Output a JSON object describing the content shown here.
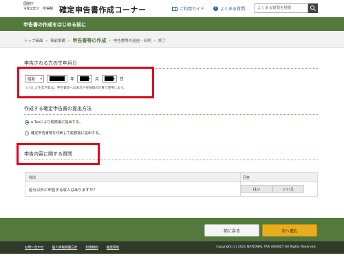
{
  "header": {
    "agency_line1": "国税庁",
    "agency_line2": "令和2年分　所得税",
    "title": "確定申告書作成コーナー",
    "guide_link": "ご利用ガイド",
    "faq_link": "よくある質問",
    "search_placeholder": "よくある質問を検索"
  },
  "banner": {
    "title": "申告書の作成をはじめる前に"
  },
  "breadcrumb": [
    {
      "label": "トップ画面",
      "current": false
    },
    {
      "label": "事前準備",
      "current": false
    },
    {
      "label": "申告書等の作成",
      "current": true
    },
    {
      "label": "申告書等の送信・印刷",
      "current": false
    },
    {
      "label": "終了",
      "current": false
    }
  ],
  "birthday": {
    "heading": "申告される方の生年月日",
    "era_value": "昭和",
    "year_unit": "年",
    "month_unit": "月",
    "day_unit": "日",
    "note": "入力した生年月日は、申告書等への表示や控除額の計算で使用します。"
  },
  "submission": {
    "heading": "作成する確定申告書の提出方法",
    "option1": "e-Taxにより税務署に提出する。",
    "option2": "確定申告書等を印刷して税務署に提出する。",
    "selected": "option1"
  },
  "questions": {
    "heading": "申告内容に関する質問",
    "col_question": "質問",
    "col_answer": "回答",
    "rows": [
      {
        "question": "給与以外に申告する収入はありますか？",
        "yes": "はい",
        "no": "いいえ"
      }
    ]
  },
  "buttons": {
    "back": "前に戻る",
    "next": "次へ進む"
  },
  "footer": {
    "links": [
      "お問い合わせ",
      "個人情報保護方針",
      "利用規約",
      "推奨環境"
    ],
    "copyright": "Copyright (c) 2021 NATIONAL TAX AGENCY All Rights Reserved."
  },
  "colors": {
    "brand_green": "#537a3c",
    "highlight_red": "#e0001b",
    "next_button": "#e8ad1e",
    "footer_bg": "#2f3a2a"
  }
}
